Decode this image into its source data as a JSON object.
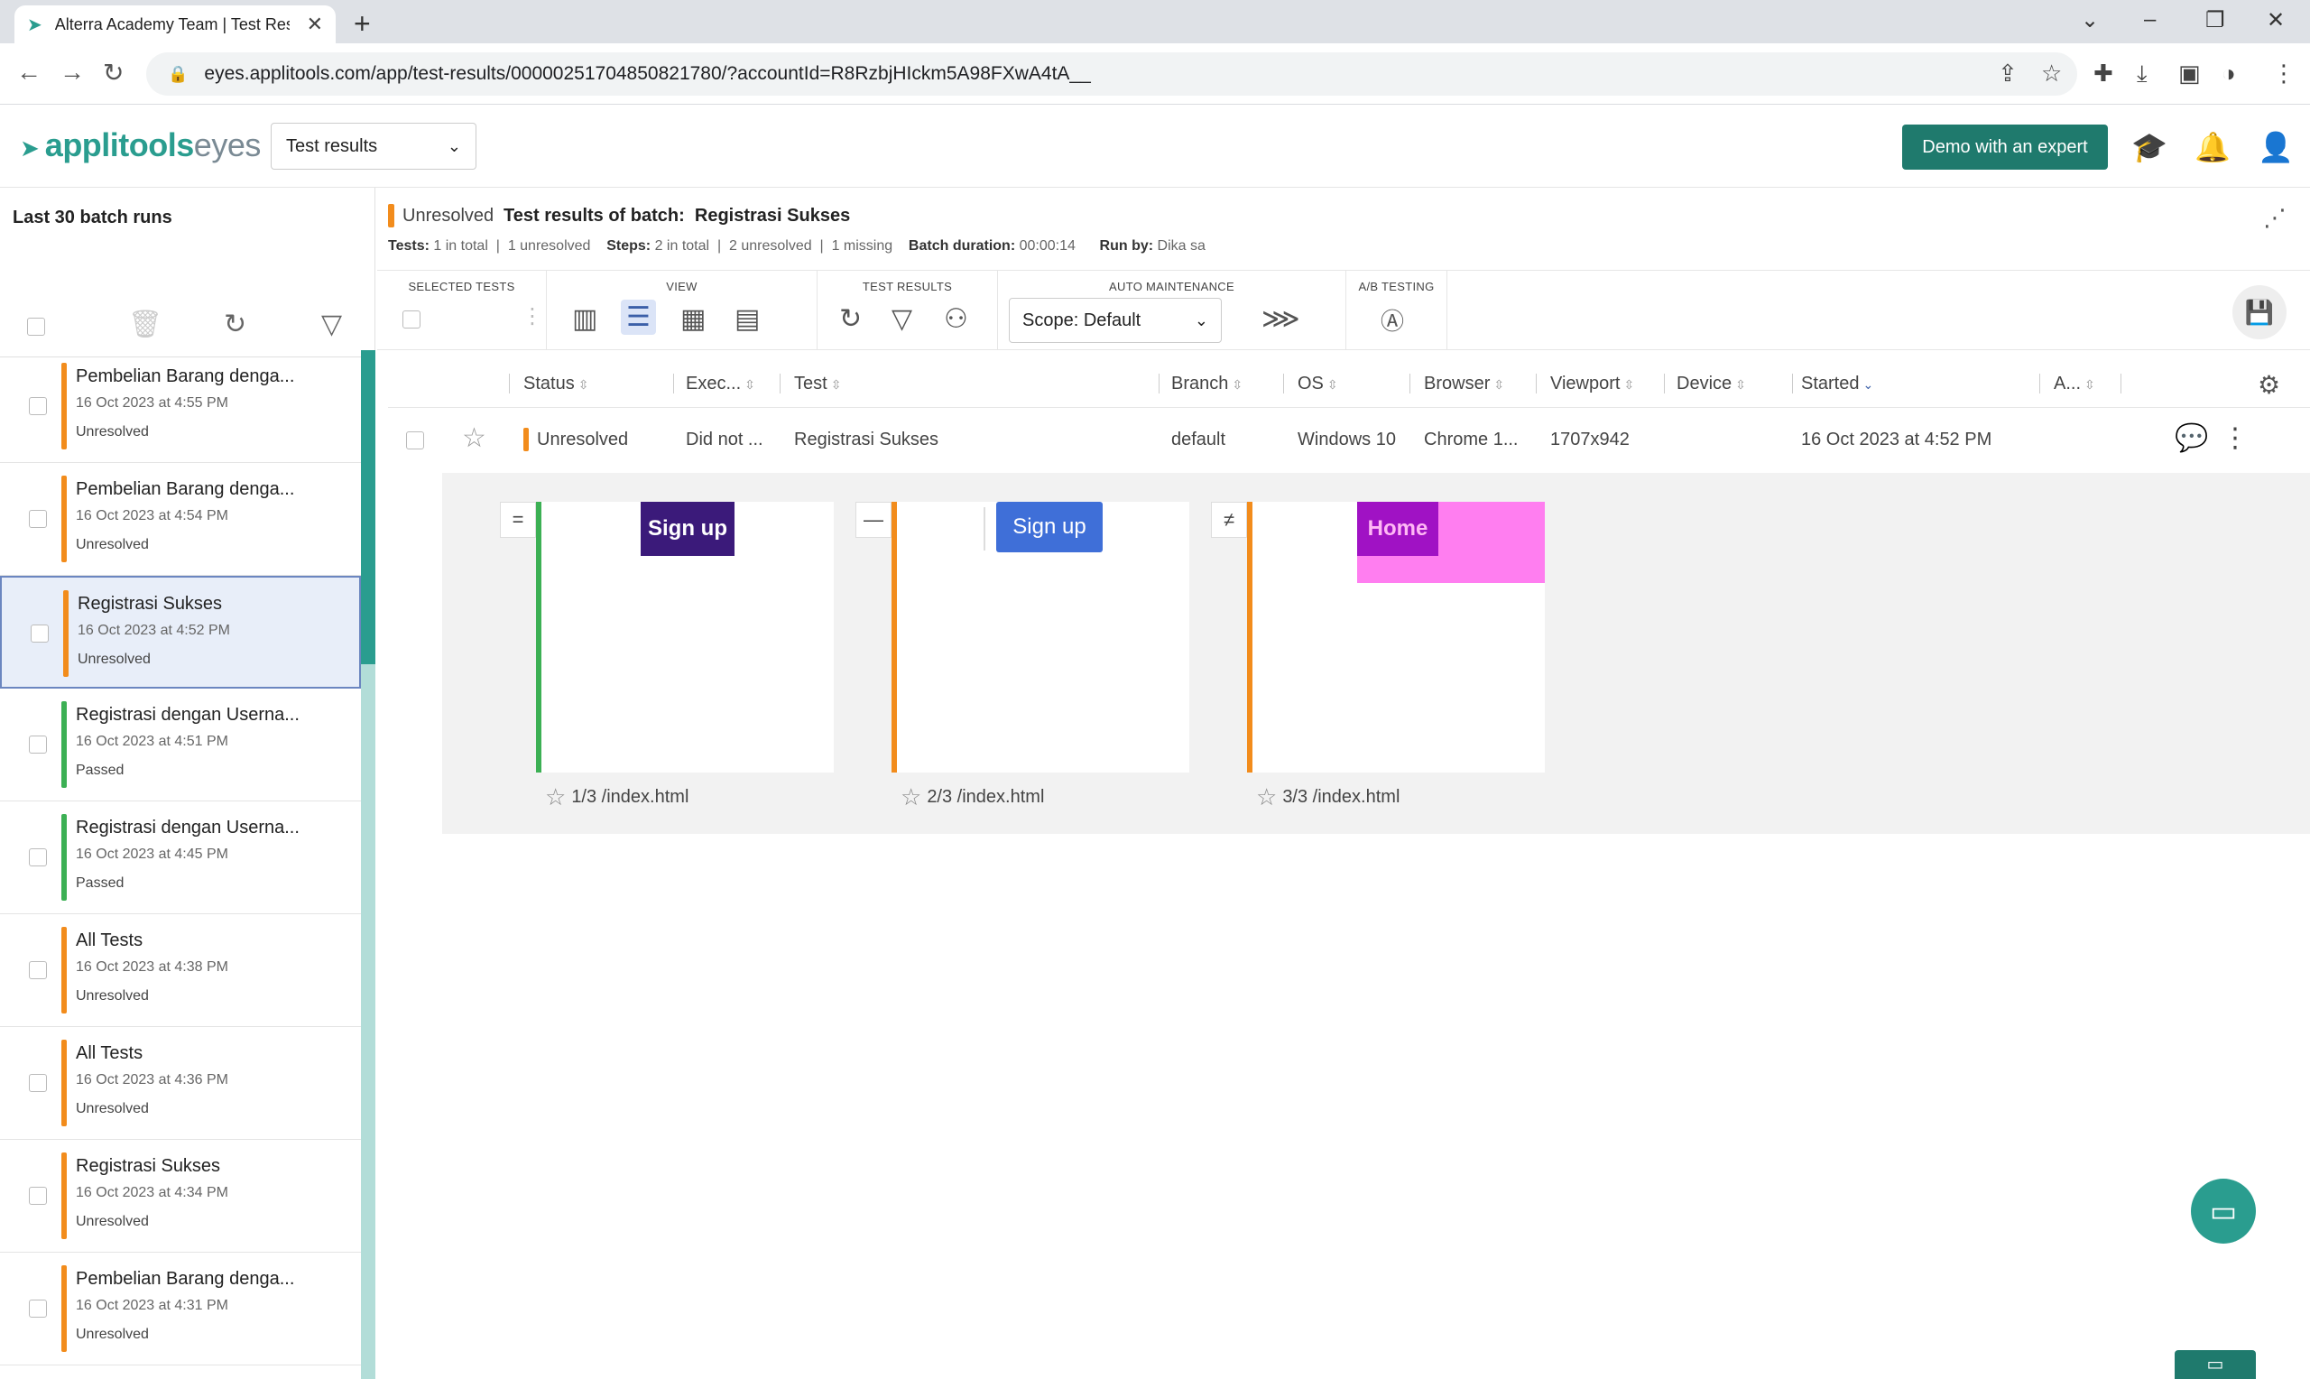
{
  "browser": {
    "tab_title": "Alterra Academy Team | Test Res",
    "url": "eyes.applitools.com/app/test-results/00000251704850821780/?accountId=R8RzbjHIckm5A98FXwA4tA__"
  },
  "header": {
    "logo_primary": "applitools",
    "logo_secondary": "eyes",
    "view_select": "Test results",
    "demo_button": "Demo with an expert"
  },
  "left_panel": {
    "title": "Last 30 batch runs",
    "batches": [
      {
        "name": "Pembelian Barang denga...",
        "date": "16 Oct 2023 at 4:55 PM",
        "status": "Unresolved",
        "color": "#f28c1c"
      },
      {
        "name": "Pembelian Barang denga...",
        "date": "16 Oct 2023 at 4:54 PM",
        "status": "Unresolved",
        "color": "#f28c1c"
      },
      {
        "name": "Registrasi Sukses",
        "date": "16 Oct 2023 at 4:52 PM",
        "status": "Unresolved",
        "color": "#f28c1c"
      },
      {
        "name": "Registrasi dengan Userna...",
        "date": "16 Oct 2023 at 4:51 PM",
        "status": "Passed",
        "color": "#3cb054"
      },
      {
        "name": "Registrasi dengan Userna...",
        "date": "16 Oct 2023 at 4:45 PM",
        "status": "Passed",
        "color": "#3cb054"
      },
      {
        "name": "All Tests",
        "date": "16 Oct 2023 at 4:38 PM",
        "status": "Unresolved",
        "color": "#f28c1c"
      },
      {
        "name": "All Tests",
        "date": "16 Oct 2023 at 4:36 PM",
        "status": "Unresolved",
        "color": "#f28c1c"
      },
      {
        "name": "Registrasi Sukses",
        "date": "16 Oct 2023 at 4:34 PM",
        "status": "Unresolved",
        "color": "#f28c1c"
      },
      {
        "name": "Pembelian Barang denga...",
        "date": "16 Oct 2023 at 4:31 PM",
        "status": "Unresolved",
        "color": "#f28c1c"
      }
    ]
  },
  "summary": {
    "status": "Unresolved",
    "title": "Test results of batch:  Registrasi Sukses",
    "tests_label": "Tests:",
    "tests_total": "1 in total",
    "tests_unresolved": "1 unresolved",
    "steps_label": "Steps:",
    "steps_total": "2 in total",
    "steps_unresolved": "2 unresolved",
    "steps_missing": "1 missing",
    "duration_label": "Batch duration:",
    "duration": "00:00:14",
    "runby_label": "Run by:",
    "runby": "Dika sa"
  },
  "toolbar": {
    "selected_tests": "SELECTED TESTS",
    "view": "VIEW",
    "test_results": "TEST RESULTS",
    "auto_maintenance": "AUTO MAINTENANCE",
    "ab_testing": "A/B TESTING",
    "scope": "Scope: Default"
  },
  "table": {
    "columns": [
      "Status",
      "Exec...",
      "Test",
      "Branch",
      "OS",
      "Browser",
      "Viewport",
      "Device",
      "Started",
      "A..."
    ],
    "row": {
      "status": "Unresolved",
      "exec": "Did not ...",
      "test": "Registrasi Sukses",
      "branch": "default",
      "os": "Windows 10",
      "browser": "Chrome 1...",
      "viewport": "1707x942",
      "device": "",
      "started": "16 Oct 2023 at 4:52 PM"
    }
  },
  "steps": [
    {
      "badge": "=",
      "label": "1/3 /index.html",
      "button": "Sign up",
      "color": "#3cb054"
    },
    {
      "badge": "—",
      "label": "2/3 /index.html",
      "button": "Sign up",
      "color": "#f28c1c"
    },
    {
      "badge": "≠",
      "label": "3/3 /index.html",
      "button": "Home",
      "color": "#f28c1c"
    }
  ]
}
